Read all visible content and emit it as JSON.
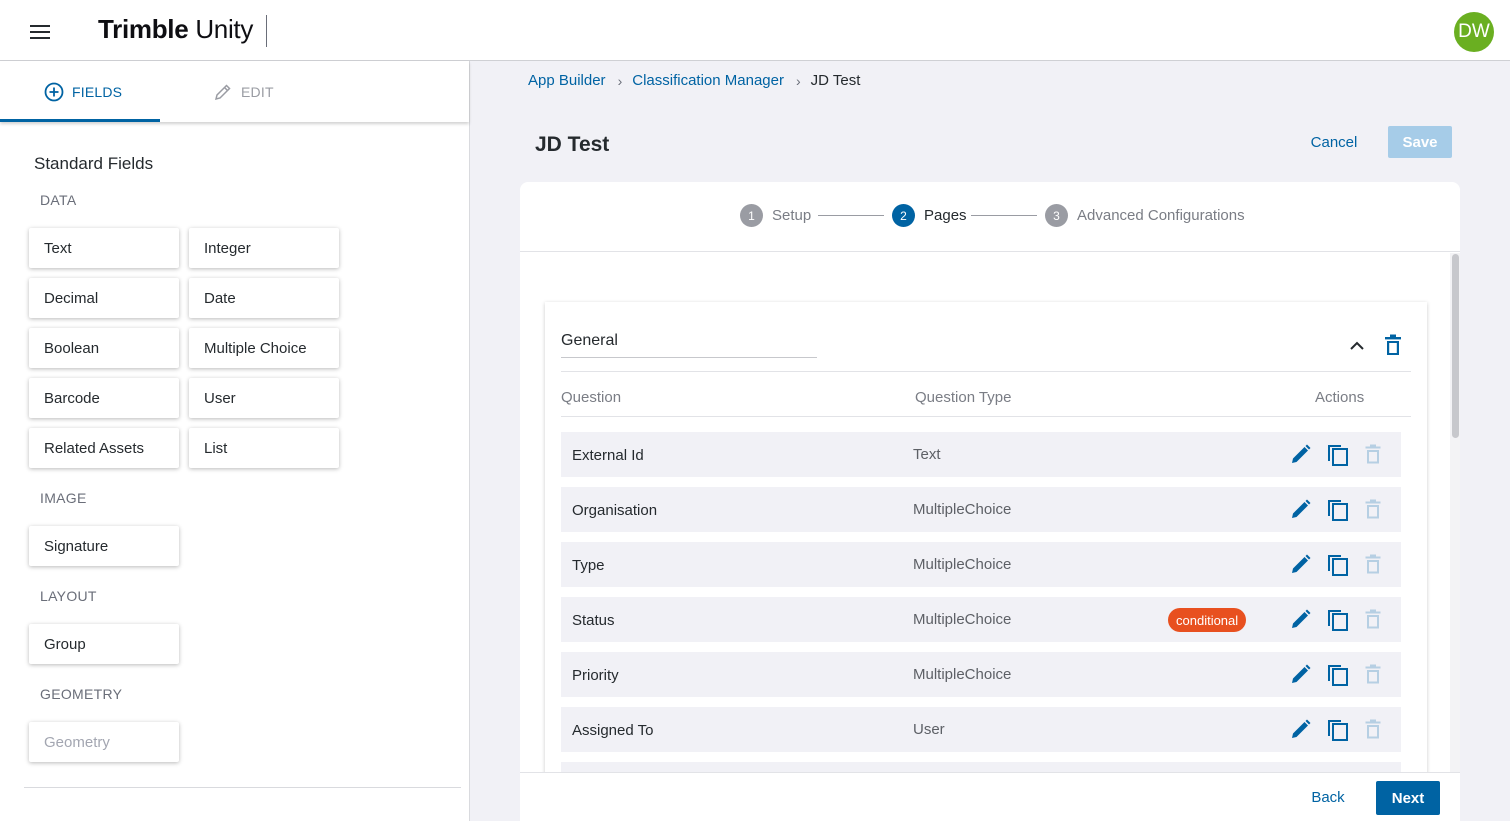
{
  "header": {
    "logo_bold": "Trimble",
    "logo_light": "Unity",
    "avatar_initials": "DW"
  },
  "left_panel": {
    "tabs": [
      {
        "label": "FIELDS",
        "icon": "add-circle-icon",
        "active": true
      },
      {
        "label": "EDIT",
        "icon": "pencil-icon",
        "active": false
      }
    ],
    "section_title": "Standard Fields",
    "groups": {
      "data": {
        "label": "DATA",
        "fields": [
          "Text",
          "Integer",
          "Decimal",
          "Date",
          "Boolean",
          "Multiple Choice",
          "Barcode",
          "User",
          "Related Assets",
          "List"
        ]
      },
      "image": {
        "label": "IMAGE",
        "fields": [
          "Signature"
        ]
      },
      "layout": {
        "label": "LAYOUT",
        "fields": [
          "Group"
        ]
      },
      "geometry": {
        "label": "GEOMETRY",
        "fields": [
          "Geometry"
        ]
      }
    }
  },
  "breadcrumb": {
    "items": [
      "App Builder",
      "Classification Manager"
    ],
    "current": "JD Test"
  },
  "page": {
    "title": "JD Test",
    "cancel_label": "Cancel",
    "save_label": "Save"
  },
  "stepper": {
    "steps": [
      {
        "num": "1",
        "label": "Setup",
        "state": "inactive"
      },
      {
        "num": "2",
        "label": "Pages",
        "state": "active"
      },
      {
        "num": "3",
        "label": "Advanced Configurations",
        "state": "inactive"
      }
    ]
  },
  "page_panel": {
    "name": "General",
    "columns": {
      "question": "Question",
      "type": "Question Type",
      "actions": "Actions"
    },
    "rows": [
      {
        "name": "External Id",
        "type": "Text",
        "badge": ""
      },
      {
        "name": "Organisation",
        "type": "MultipleChoice",
        "badge": ""
      },
      {
        "name": "Type",
        "type": "MultipleChoice",
        "badge": ""
      },
      {
        "name": "Status",
        "type": "MultipleChoice",
        "badge": "conditional"
      },
      {
        "name": "Priority",
        "type": "MultipleChoice",
        "badge": ""
      },
      {
        "name": "Assigned To",
        "type": "User",
        "badge": ""
      }
    ]
  },
  "footer": {
    "back_label": "Back",
    "next_label": "Next"
  },
  "colors": {
    "primary": "#0063a3",
    "avatar": "#6aaf21",
    "badge": "#e8501f",
    "save_disabled": "#a6cce8",
    "row_bg": "#f1f1f6"
  }
}
